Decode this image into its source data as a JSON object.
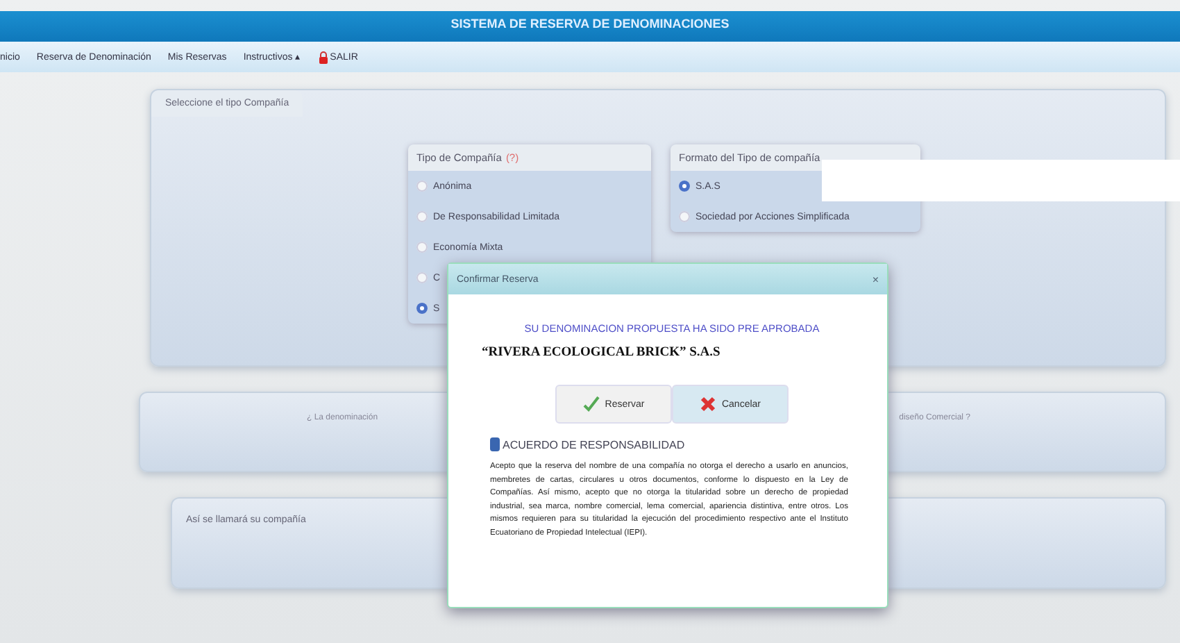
{
  "header": {
    "title": "SISTEMA DE RESERVA DE DENOMINACIONES"
  },
  "nav": [
    {
      "label": "nicio",
      "kind": "link"
    },
    {
      "label": "Reserva de Denominación",
      "kind": "link"
    },
    {
      "label": "Mis Reservas",
      "kind": "link"
    },
    {
      "label": "Instructivos",
      "kind": "menu",
      "caret": "▴"
    },
    {
      "label": "SALIR",
      "kind": "exit"
    }
  ],
  "company_panel": {
    "title": "Seleccione el tipo Compañía",
    "type_group": {
      "title": "Tipo de Compañía",
      "help": "(?)",
      "options": [
        {
          "label": "Anónima",
          "selected": false
        },
        {
          "label": "De Responsabilidad Limitada",
          "selected": false
        },
        {
          "label": "Economía Mixta",
          "selected": false
        },
        {
          "label": "C",
          "selected": false
        },
        {
          "label": "S",
          "selected": true
        }
      ]
    },
    "format_group": {
      "title": "Formato del Tipo de compañía",
      "options": [
        {
          "label": "S.A.S",
          "selected": true
        },
        {
          "label": "Sociedad por Acciones Simplificada",
          "selected": false
        }
      ]
    }
  },
  "question_panel": {
    "left": "¿ La denominación",
    "right": "diseño Comercial ?"
  },
  "name_panel": {
    "title": "Así se llamará su compañía"
  },
  "dialog": {
    "title": "Confirmar Reserva",
    "close": "×",
    "message": "SU DENOMINACION PROPUESTA HA SIDO PRE APROBADA",
    "name": "“RIVERA ECOLOGICAL BRICK” S.A.S",
    "buttons": [
      {
        "label": "Reservar",
        "kind": "confirm"
      },
      {
        "label": "Cancelar",
        "kind": "cancel"
      }
    ],
    "agreement_title": "ACUERDO DE RESPONSABILIDAD",
    "agreement_text": "Acepto que la reserva del nombre de una compañía no otorga el derecho a usarlo en anuncios, membretes de cartas, circulares u otros documentos, conforme lo dispuesto en la Ley de Compañías. Así mismo, acepto que no otorga la titularidad sobre un derecho de propiedad industrial, sea marca, nombre comercial, lema comercial, apariencia distintiva, entre otros. Los mismos requieren para su titularidad la ejecución del procedimiento respectivo ante el Instituto Ecuatoriano de Propiedad Intelectual (IEPI)."
  }
}
